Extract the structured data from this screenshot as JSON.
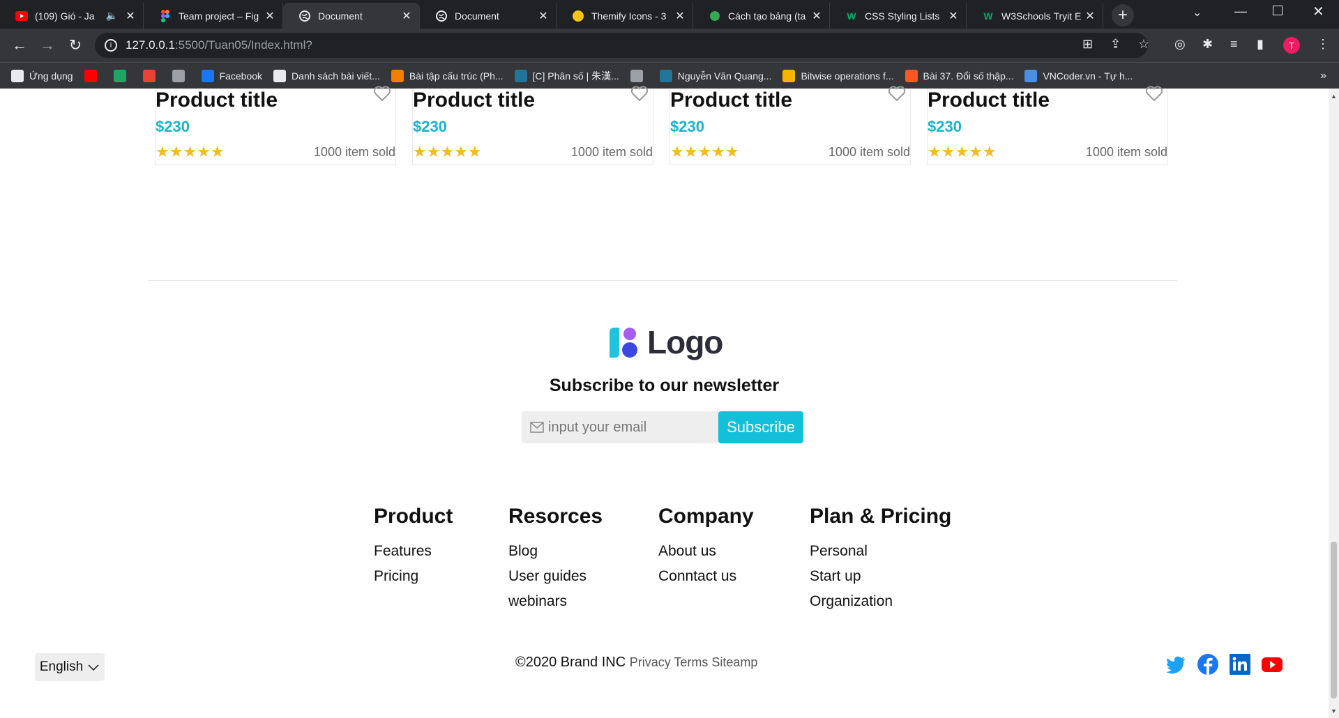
{
  "browser": {
    "tabs": [
      {
        "title": "(109) Gió - Ja",
        "icon": "youtube-icon"
      },
      {
        "title": "Team project – Fig",
        "icon": "figma-icon"
      },
      {
        "title": "Document",
        "icon": "globe-icon"
      },
      {
        "title": "Document",
        "icon": "globe-icon"
      },
      {
        "title": "Themify Icons - 3",
        "icon": "emoji-icon"
      },
      {
        "title": "Cách tạo bảng (ta",
        "icon": "sheet-icon"
      },
      {
        "title": "CSS Styling Lists",
        "icon": "w3schools-icon"
      },
      {
        "title": "W3Schools Tryit E",
        "icon": "w3schools-icon"
      }
    ],
    "url_host": "127.0.0.1",
    "url_path": ":5500/Tuan05/Index.html?",
    "bookmarks": [
      {
        "label": "Ứng dụng",
        "color": "#e8eaed"
      },
      {
        "label": "",
        "color": "#ff0000"
      },
      {
        "label": "",
        "color": "#1fa463"
      },
      {
        "label": "",
        "color": "#ea4335"
      },
      {
        "label": "",
        "color": "#9aa0a6"
      },
      {
        "label": "Facebook",
        "color": "#1877f2"
      },
      {
        "label": "Danh sách bài viết...",
        "color": "#e8eaed"
      },
      {
        "label": "Bài tập cấu trúc (Ph...",
        "color": "#f57d00"
      },
      {
        "label": "[C] Phân số | 朱漢...",
        "color": "#21759b"
      },
      {
        "label": "",
        "color": "#9aa0a6"
      },
      {
        "label": "Nguyễn Văn Quang...",
        "color": "#21759b"
      },
      {
        "label": "Bitwise operations f...",
        "color": "#f4b400"
      },
      {
        "label": "Bài 37. Đổi số thập...",
        "color": "#ff5722"
      },
      {
        "label": "VNCoder.vn - Tự h...",
        "color": "#4a90e2"
      }
    ],
    "profile_initial": "T"
  },
  "products": [
    {
      "title": "Product title",
      "price": "$230",
      "stars": "★★★★★",
      "sold": "1000 item sold"
    },
    {
      "title": "Product title",
      "price": "$230",
      "stars": "★★★★★",
      "sold": "1000 item sold"
    },
    {
      "title": "Product title",
      "price": "$230",
      "stars": "★★★★★",
      "sold": "1000 item sold"
    },
    {
      "title": "Product title",
      "price": "$230",
      "stars": "★★★★★",
      "sold": "1000 item sold"
    }
  ],
  "footer": {
    "logo_text": "Logo",
    "newsletter_title": "Subscribe to our newsletter",
    "email_placeholder": "input your email",
    "subscribe_label": "Subscribe",
    "columns": [
      {
        "heading": "Product",
        "links": [
          "Features",
          "Pricing"
        ]
      },
      {
        "heading": "Resorces",
        "links": [
          "Blog",
          "User guides",
          "webinars"
        ]
      },
      {
        "heading": "Company",
        "links": [
          "About us",
          "Conntact us"
        ]
      },
      {
        "heading": "Plan & Pricing",
        "links": [
          "Personal",
          "Start up",
          "Organization"
        ]
      }
    ],
    "language": "English",
    "copyright": "©2020 Brand INC",
    "legal_links": "Privacy Terms Siteamp",
    "social": [
      "twitter-icon",
      "facebook-icon",
      "linkedin-icon",
      "youtube-icon"
    ]
  },
  "colors": {
    "accent": "#12c1d9",
    "price": "#17b4cf",
    "star": "#f5b921"
  }
}
